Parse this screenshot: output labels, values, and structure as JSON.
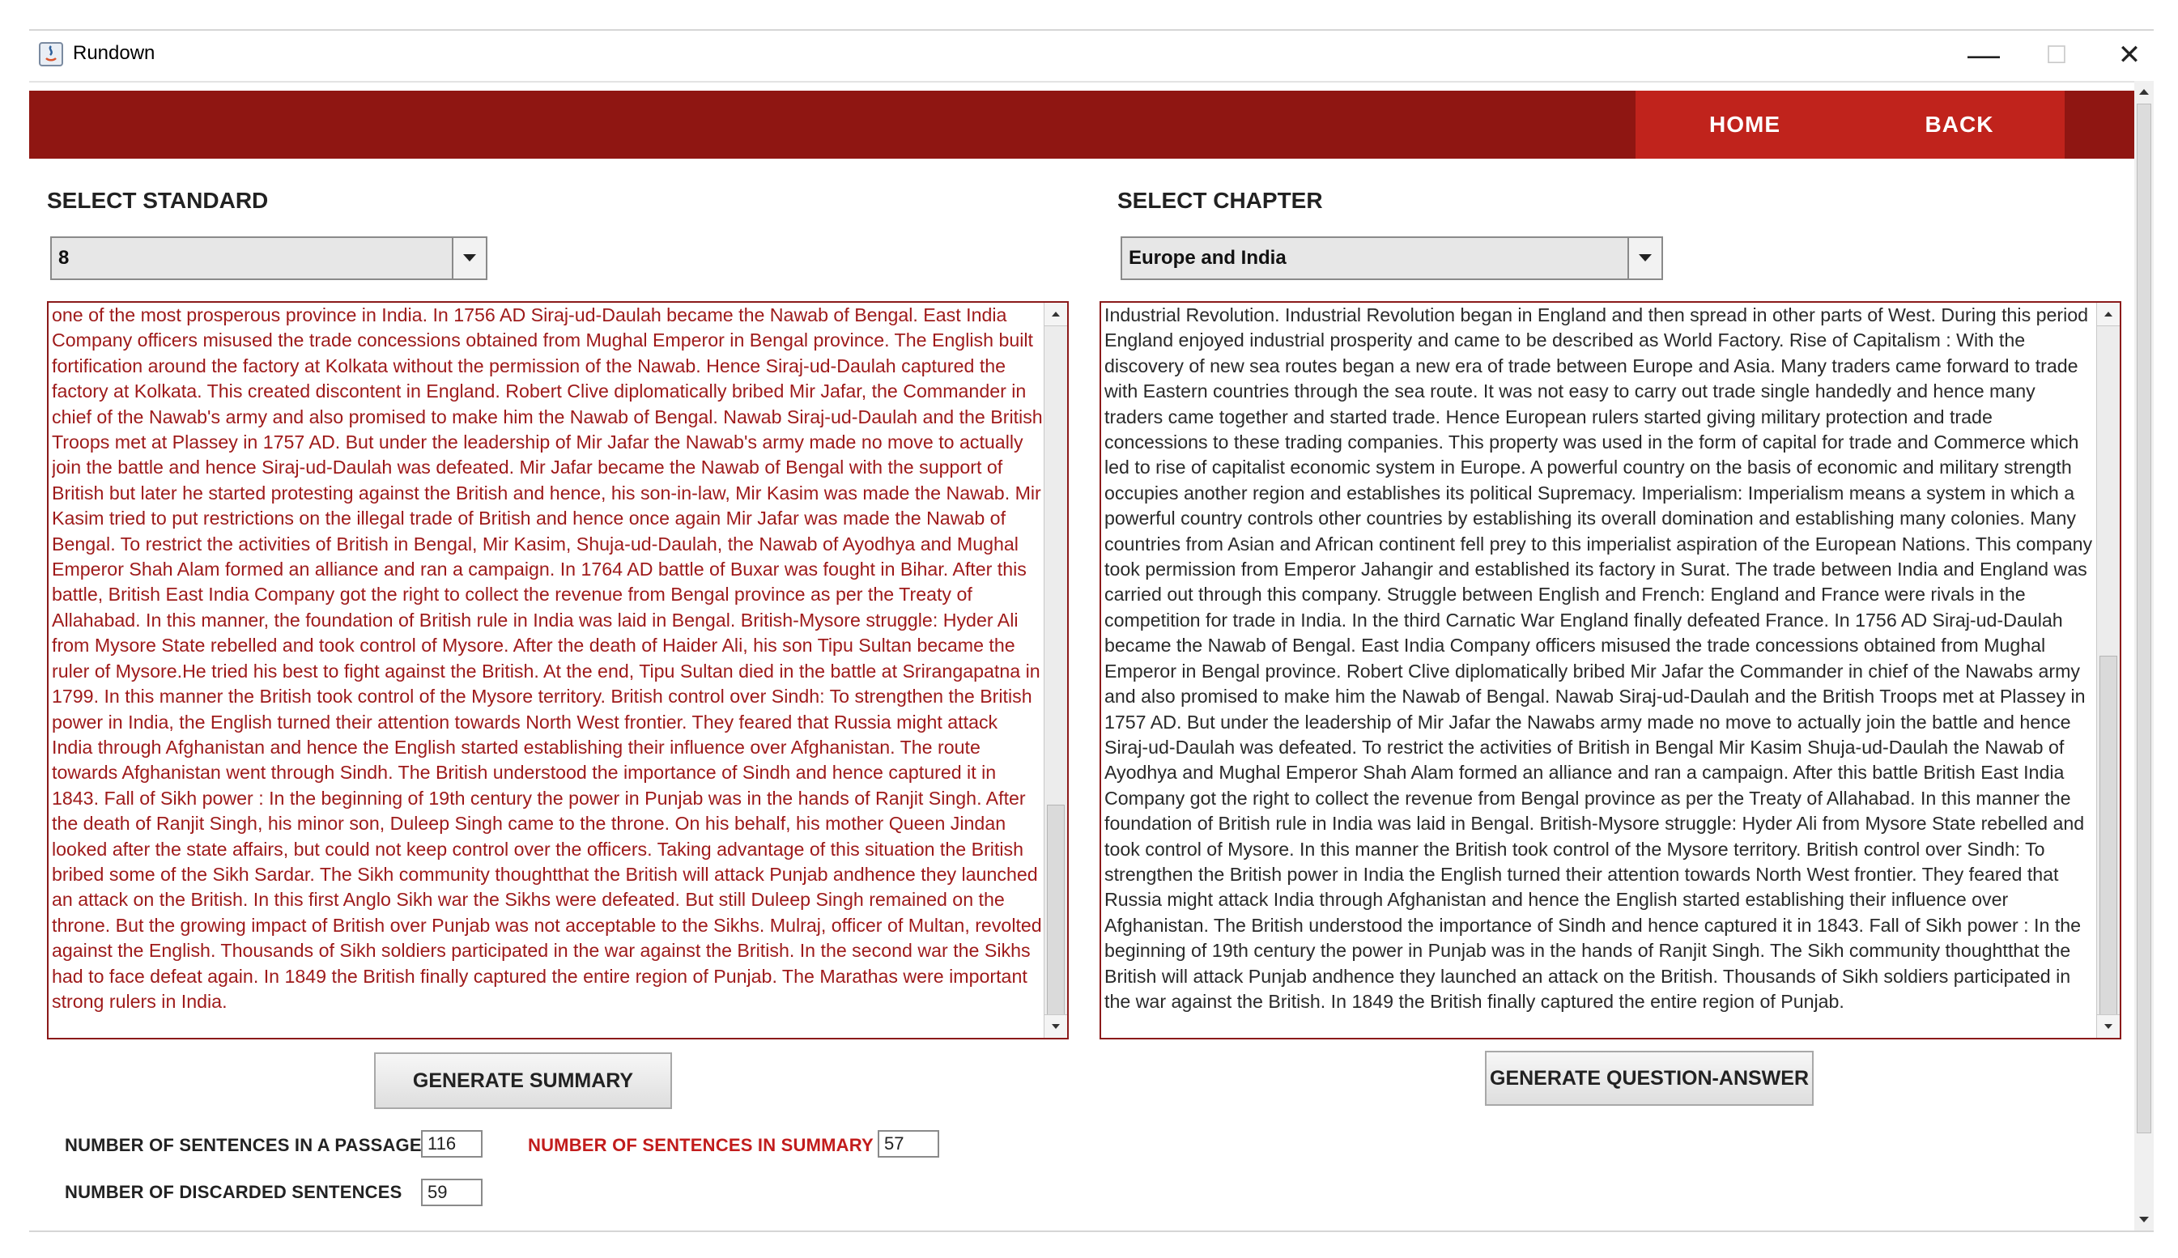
{
  "window": {
    "title": "Rundown",
    "minimize_glyph": "—",
    "maximize_glyph": "☐",
    "close_glyph": "✕"
  },
  "nav": {
    "home_label": "HOME",
    "back_label": "BACK"
  },
  "colors": {
    "header_bg": "#8f1612",
    "nav_bg": "#c0231c",
    "passage_text": "#9e1a1a",
    "summary_label": "#c21c1c"
  },
  "left_panel": {
    "label": "SELECT STANDARD",
    "selected_standard": "8",
    "passage_text": "one of the most prosperous province in India. In 1756 AD Siraj-ud-Daulah became the Nawab of Bengal. East India Company officers misused the trade concessions obtained from Mughal Emperor in Bengal province. The English built fortification around the factory at Kolkata without the permission of the Nawab. Hence Siraj-ud-Daulah captured the factory at Kolkata. This created discontent in England. Robert Clive diplomatically bribed Mir Jafar, the Commander in chief of the Nawab's army and also promised to make him the Nawab of Bengal. Nawab Siraj-ud-Daulah and the British Troops met at Plassey in 1757 AD. But under the leadership of Mir Jafar the Nawab's army made no move to actually join the battle and hence Siraj-ud-Daulah was defeated. Mir Jafar became the Nawab of Bengal with the support of British but later he started protesting against the British and hence, his son-in-law, Mir Kasim was made the Nawab. Mir Kasim tried to put restrictions on the illegal trade of British and hence once again Mir Jafar was made the Nawab of Bengal. To restrict the activities of British in Bengal, Mir Kasim, Shuja-ud-Daulah, the Nawab of Ayodhya and Mughal Emperor Shah Alam formed an alliance and ran a campaign. In 1764 AD battle of Buxar was fought in Bihar. After this battle, British East India Company got the right to collect the revenue from Bengal province as per the Treaty of Allahabad. In this manner, the foundation of British rule in India was laid in Bengal. British-Mysore struggle: Hyder Ali from Mysore State rebelled and took control of Mysore. After the death of Haider Ali, his son Tipu Sultan became the ruler of Mysore.He tried his best to fight against the British. At the end, Tipu Sultan died in the battle at Srirangapatna in 1799. In this manner the British took control of the Mysore territory. British control over Sindh: To strengthen the British power in India, the English turned their attention towards North West frontier. They feared that Russia might attack India through Afghanistan and hence the English started establishing their influence over Afghanistan. The route towards Afghanistan went through Sindh. The British understood the importance of Sindh and hence captured it in 1843. Fall of Sikh power : In the beginning of 19th century the power in Punjab was in the hands of Ranjit Singh. After the death of Ranjit Singh, his minor son, Duleep Singh came to the throne. On his behalf, his mother Queen Jindan looked after the state affairs, but could not keep control over the officers. Taking advantage of this situation the British bribed some of the Sikh Sardar. The Sikh community thoughtthat the British will attack Punjab andhence they launched an attack on the British. In this first Anglo Sikh war the Sikhs were defeated. But still Duleep Singh remained on the throne. But the growing impact of British over Punjab was not acceptable to the Sikhs. Mulraj, officer of Multan, revolted against the English. Thousands of Sikh soldiers participated in the war against the British. In the second war the Sikhs had to face defeat again. In 1849 the British finally captured the entire region of Punjab. The Marathas were important strong rulers in India.",
    "generate_button": "GENERATE SUMMARY"
  },
  "right_panel": {
    "label": "SELECT CHAPTER",
    "selected_chapter": "Europe and India",
    "summary_text": "Industrial Revolution. Industrial Revolution began in England and then spread in other parts of West. During this period England enjoyed industrial prosperity and came to be described as World Factory. Rise of Capitalism : With the discovery of new sea routes began a new era of trade between Europe and Asia. Many traders came forward to trade with Eastern countries through the sea route. It was not easy to carry out trade single handedly and hence many traders came together and started trade. Hence European rulers started giving military protection and trade concessions to these trading companies. This property was used in the form of capital for trade and Commerce which led to rise of capitalist economic system in Europe. A powerful country on the basis of economic and military strength occupies another region and establishes its political Supremacy. Imperialism: Imperialism means a system in which a powerful country controls other countries by establishing its overall domination and establishing many colonies. Many countries from Asian and African continent fell prey to this imperialist aspiration of the European Nations. This company took permission from Emperor Jahangir and established its factory in Surat. The trade between India and England was carried out through this company. Struggle between English and French: England and France were rivals in the competition for trade in India. In the third Carnatic War England finally defeated France. In 1756 AD Siraj-ud-Daulah became the Nawab of Bengal. East India Company officers misused the trade concessions obtained from Mughal Emperor in Bengal province. Robert Clive diplomatically bribed Mir Jafar the Commander in chief of the Nawabs army and also promised to make him the Nawab of Bengal. Nawab Siraj-ud-Daulah and the British Troops met at Plassey in 1757 AD. But under the leadership of Mir Jafar the Nawabs army made no move to actually join the battle and hence Siraj-ud-Daulah was defeated. To restrict the activities of British in Bengal Mir Kasim Shuja-ud-Daulah the Nawab of Ayodhya and Mughal Emperor Shah Alam formed an alliance and ran a campaign. After this battle British East India Company got the right to collect the revenue from Bengal province as per the Treaty of Allahabad. In this manner the foundation of British rule in India was laid in Bengal. British-Mysore struggle: Hyder Ali from Mysore State rebelled and took control of Mysore. In this manner the British took control of the Mysore territory. British control over Sindh: To strengthen the British power in India the English turned their attention towards North West frontier. They feared that Russia might attack India through Afghanistan and hence the English started establishing their influence over Afghanistan. The British understood the importance of Sindh and hence captured it in 1843. Fall of Sikh power : In the beginning of 19th century the power in Punjab was in the hands of Ranjit Singh. The Sikh community thoughtthat the British will attack Punjab andhence they launched an attack on the British. Thousands of Sikh soldiers participated in the war against the British. In 1849 the British finally captured the entire region of Punjab.",
    "generate_button": "GENERATE QUESTION-ANSWER"
  },
  "stats": {
    "passage_label": "NUMBER OF SENTENCES IN A PASSAGE",
    "passage_count": "116",
    "summary_label": "NUMBER OF SENTENCES IN SUMMARY",
    "summary_count": "57",
    "discarded_label": "NUMBER OF DISCARDED SENTENCES",
    "discarded_count": "59"
  }
}
